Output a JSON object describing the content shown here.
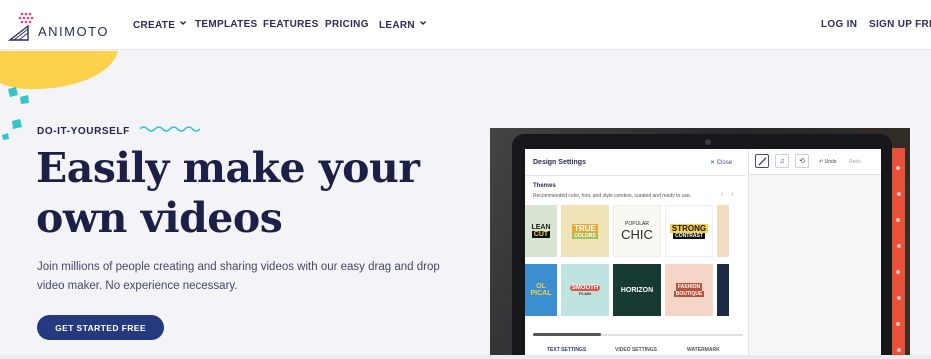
{
  "brand": {
    "name": "ANIMOTO"
  },
  "nav": {
    "items": [
      {
        "label": "CREATE",
        "has_dropdown": true
      },
      {
        "label": "TEMPLATES",
        "has_dropdown": false
      },
      {
        "label": "FEATURES",
        "has_dropdown": false
      },
      {
        "label": "PRICING",
        "has_dropdown": false
      },
      {
        "label": "LEARN",
        "has_dropdown": true
      }
    ],
    "login": "LOG IN",
    "signup": "SIGN UP FREE"
  },
  "hero": {
    "eyebrow": "DO-IT-YOURSELF",
    "headline_line1": "Easily make your",
    "headline_line2": "own videos",
    "subtext_line1": "Join millions of people creating and sharing videos with our easy drag and drop",
    "subtext_line2": "video maker. No experience necessary.",
    "cta": "GET STARTED FREE"
  },
  "app_preview": {
    "panel_title": "Design Settings",
    "close_label": "Close",
    "section_title": "Themes",
    "section_desc": "Recommended color, font, and style combos, curated and ready to use.",
    "tiles_row1": [
      {
        "line1": "LEAN",
        "line2": "CUT"
      },
      {
        "line1": "TRUE",
        "line2": "COLORS"
      },
      {
        "line1": "POPULAR",
        "line2": "CHIC"
      },
      {
        "line1": "STRONG",
        "line2": "CONTRAST"
      }
    ],
    "tiles_row2": [
      {
        "line1": "OL",
        "line2": "PICAL"
      },
      {
        "line1": "SMOOTH",
        "line2": "PLAIN"
      },
      {
        "line1": "HORIZON",
        "line2": ""
      },
      {
        "line1": "FASHION",
        "line2": "BOUTIQUE"
      }
    ],
    "bottom_tabs": [
      "TEXT SETTINGS",
      "VIDEO SETTINGS",
      "WATERMARK"
    ],
    "undo_label": "Undo",
    "redo_label": "Redo"
  },
  "colors": {
    "cta": "#253a7e",
    "headline": "#1c2046",
    "accent_yellow": "#fbd24a",
    "accent_teal": "#35c4c9",
    "accent_pink": "#e0427a",
    "stripe": "#e8503a"
  }
}
